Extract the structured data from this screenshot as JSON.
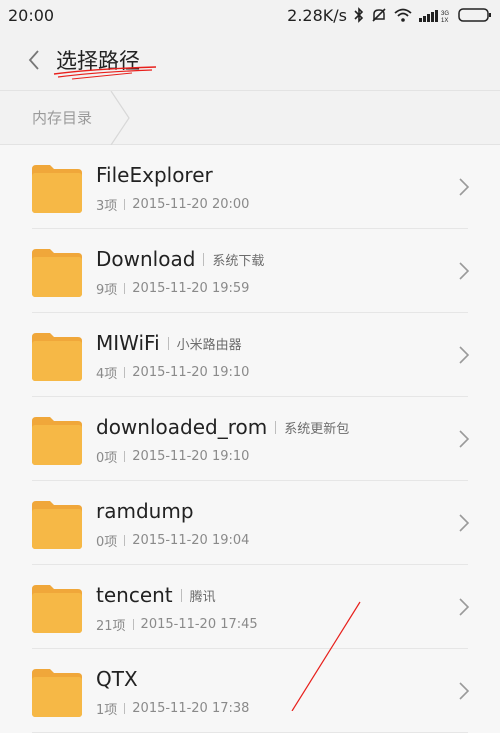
{
  "status": {
    "time": "20:00",
    "speed": "2.28K/s",
    "icons": [
      "bluetooth-icon",
      "mute-icon",
      "wifi-icon",
      "signal-icon",
      "battery-icon"
    ]
  },
  "header": {
    "title": "选择路径",
    "back_icon": "chevron-left-icon"
  },
  "breadcrumb": {
    "items": [
      "内存目录"
    ]
  },
  "folders": [
    {
      "name": "FileExplorer",
      "tag": "",
      "count": "3项",
      "date": "2015-11-20 20:00"
    },
    {
      "name": "Download",
      "tag": "系统下载",
      "count": "9项",
      "date": "2015-11-20 19:59"
    },
    {
      "name": "MIWiFi",
      "tag": "小米路由器",
      "count": "4项",
      "date": "2015-11-20 19:10"
    },
    {
      "name": "downloaded_rom",
      "tag": "系统更新包",
      "count": "0项",
      "date": "2015-11-20 19:10"
    },
    {
      "name": "ramdump",
      "tag": "",
      "count": "0项",
      "date": "2015-11-20 19:04"
    },
    {
      "name": "tencent",
      "tag": "腾讯",
      "count": "21项",
      "date": "2015-11-20 17:45"
    },
    {
      "name": "QTX",
      "tag": "",
      "count": "1项",
      "date": "2015-11-20 17:38"
    }
  ],
  "colors": {
    "folder": "#f6b846",
    "folder_tab": "#f0a73a",
    "annotation": "#e8201c"
  }
}
